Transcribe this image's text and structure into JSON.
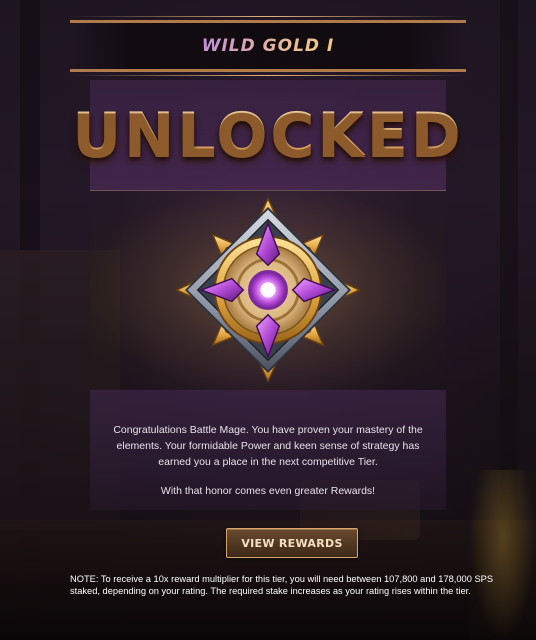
{
  "tier": {
    "title": "WILD GOLD I"
  },
  "headline": {
    "text": "UNLOCKED"
  },
  "emblem": {
    "icon": "gold-tier-emblem-icon"
  },
  "message": {
    "paragraph_1": "Congratulations Battle Mage. You have proven your mastery of the elements. Your formidable Power and keen sense of strategy has earned you a place in the next competitive Tier.",
    "paragraph_2": "With that honor comes even greater Rewards!"
  },
  "actions": {
    "view_rewards_label": "VIEW REWARDS"
  },
  "note": {
    "text": "NOTE: To receive a 10x reward multiplier for this tier, you will need between 107,800 and 178,000 SPS staked, depending on your rating. The required stake increases as your rating rises within the tier."
  },
  "colors": {
    "accent_gold": "#f0b672",
    "accent_purple": "#c58dd6",
    "banner_border": "#b07a4a",
    "button_border": "#d9a46a"
  }
}
